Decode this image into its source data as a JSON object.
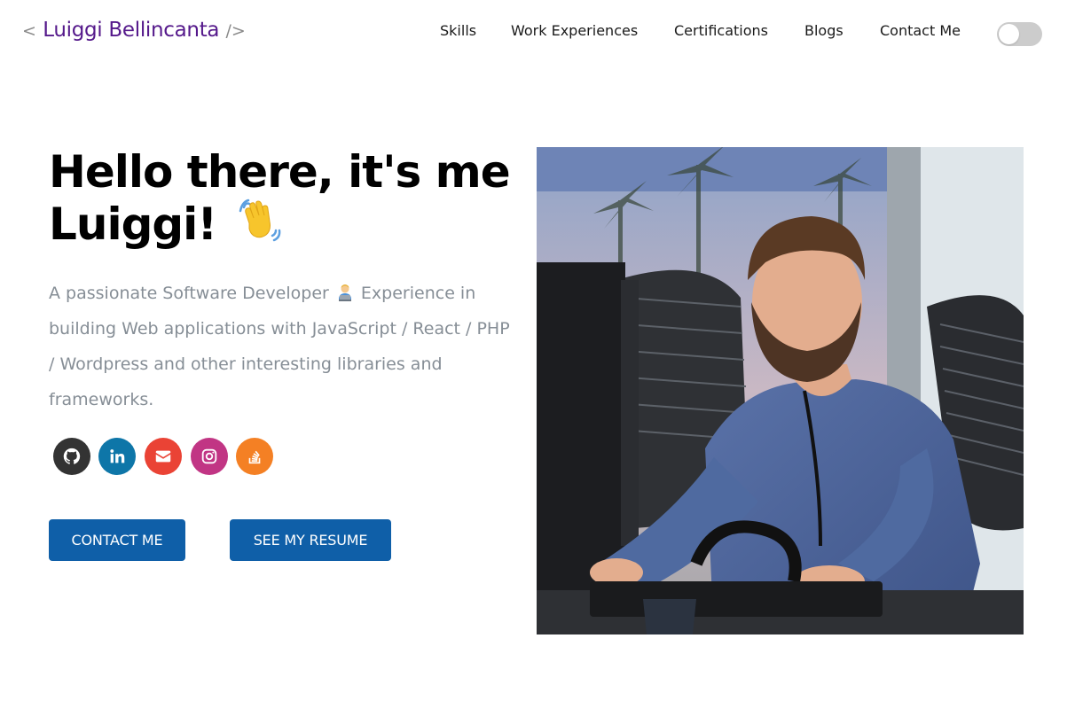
{
  "header": {
    "logo_open": "<",
    "logo_name": "Luiggi Bellincanta",
    "logo_close": "/>",
    "nav": [
      "Skills",
      "Work Experiences",
      "Certifications",
      "Blogs",
      "Contact Me"
    ],
    "theme_toggle_icon": "toggle-switch"
  },
  "hero": {
    "greeting_line1": "Hello there, it's me",
    "greeting_line2": "Luiggi!",
    "wave_icon": "waving-hand-icon",
    "subtitle_part1": "A passionate Software Developer",
    "subtitle_emoji": "technologist-icon",
    "subtitle_part2": "Experience in building Web applications with JavaScript / React / PHP / Wordpress and other interesting libraries and frameworks.",
    "socials": [
      {
        "name": "github",
        "color": "#333333"
      },
      {
        "name": "linkedin",
        "color": "#0e76a8"
      },
      {
        "name": "email",
        "color": "#ea4335"
      },
      {
        "name": "instagram",
        "color": "#c13584"
      },
      {
        "name": "stack-overflow",
        "color": "#f48024"
      }
    ],
    "button_contact": "CONTACT ME",
    "button_resume": "SEE MY RESUME",
    "photo_alt": "developer-photo"
  },
  "colors": {
    "accent": "#55198b",
    "button": "#0f5fa8",
    "subtitle": "#868e96"
  }
}
